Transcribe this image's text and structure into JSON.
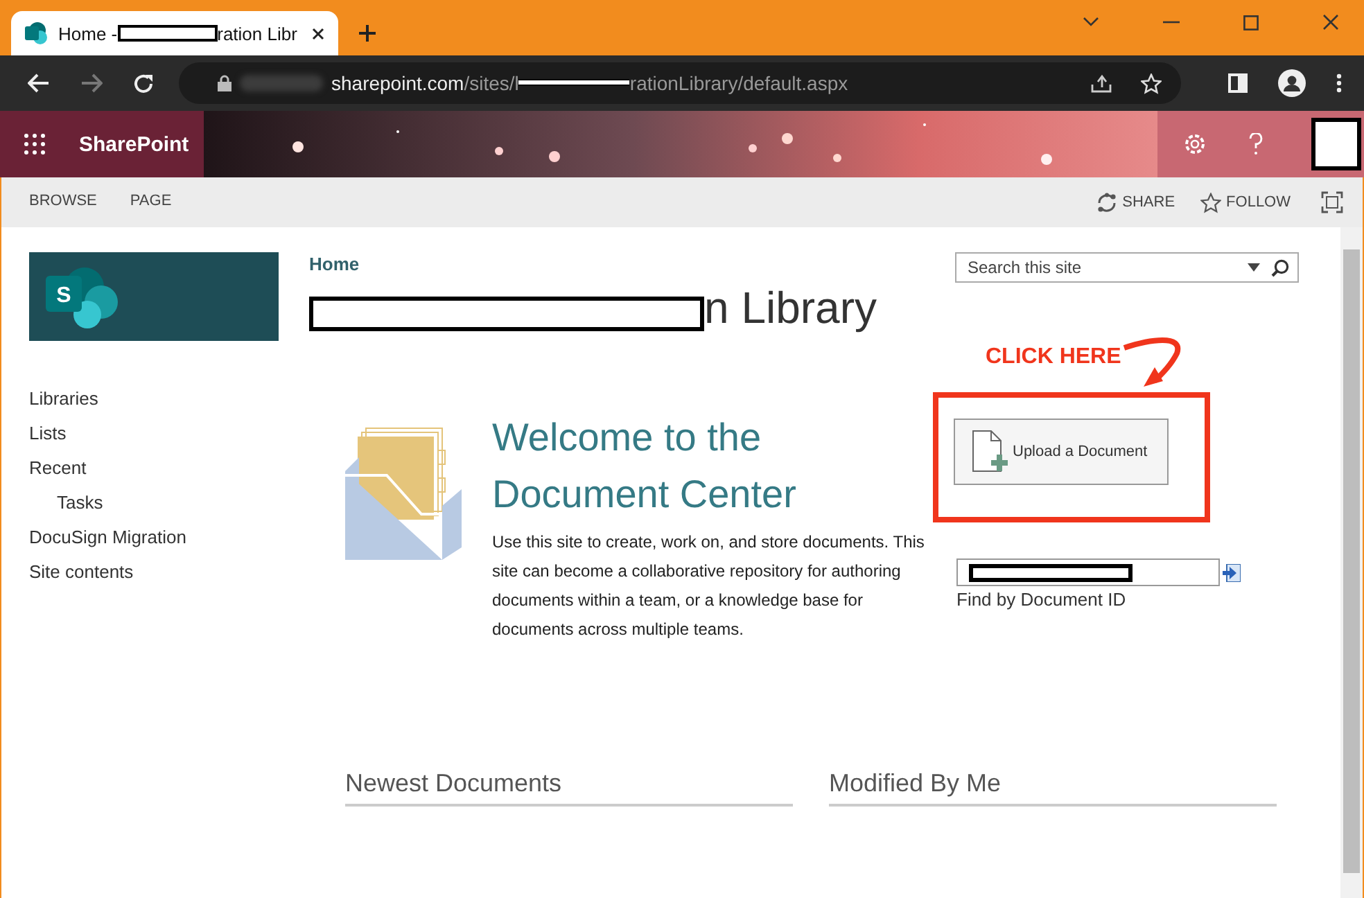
{
  "browser": {
    "tabs": [
      {
        "title_start": "Home - ",
        "title_end": "ration Libr",
        "redacted": true,
        "selected": true
      }
    ],
    "address": {
      "host": "sharepoint.com",
      "path_start": "/sites/l",
      "path_end": "rationLibrary/default.aspx",
      "redacted": true
    }
  },
  "suite_bar": {
    "app_name": "SharePoint"
  },
  "ribbon": {
    "tabs": [
      {
        "label": "BROWSE",
        "selected": false
      },
      {
        "label": "PAGE",
        "selected": false
      }
    ],
    "actions": [
      {
        "label": "SHARE",
        "kind": "share"
      },
      {
        "label": "FOLLOW",
        "kind": "follow"
      }
    ]
  },
  "breadcrumb": "Home",
  "site_title": {
    "visible_end": "n Library",
    "redacted": true
  },
  "search": {
    "placeholder": "Search this site"
  },
  "site_logo": {
    "letter": "S"
  },
  "nav": [
    {
      "label": "Libraries"
    },
    {
      "label": "Lists"
    },
    {
      "label": "Recent",
      "children": [
        {
          "label": "Tasks"
        }
      ]
    },
    {
      "label": "DocuSign Migration"
    },
    {
      "label": "Site contents"
    }
  ],
  "welcome": {
    "heading": "Welcome to the Document Center",
    "body": "Use this site to create, work on, and store documents. This site can become a collaborative repository for authoring documents within a team, or a knowledge base for documents across multiple teams."
  },
  "annotation": {
    "label": "CLICK HERE"
  },
  "upload_button": {
    "label": "Upload a Document"
  },
  "find_by_id": {
    "redacted": true,
    "label": "Find by Document ID"
  },
  "sections": [
    {
      "title": "Newest Documents"
    },
    {
      "title": "Modified By Me"
    }
  ]
}
